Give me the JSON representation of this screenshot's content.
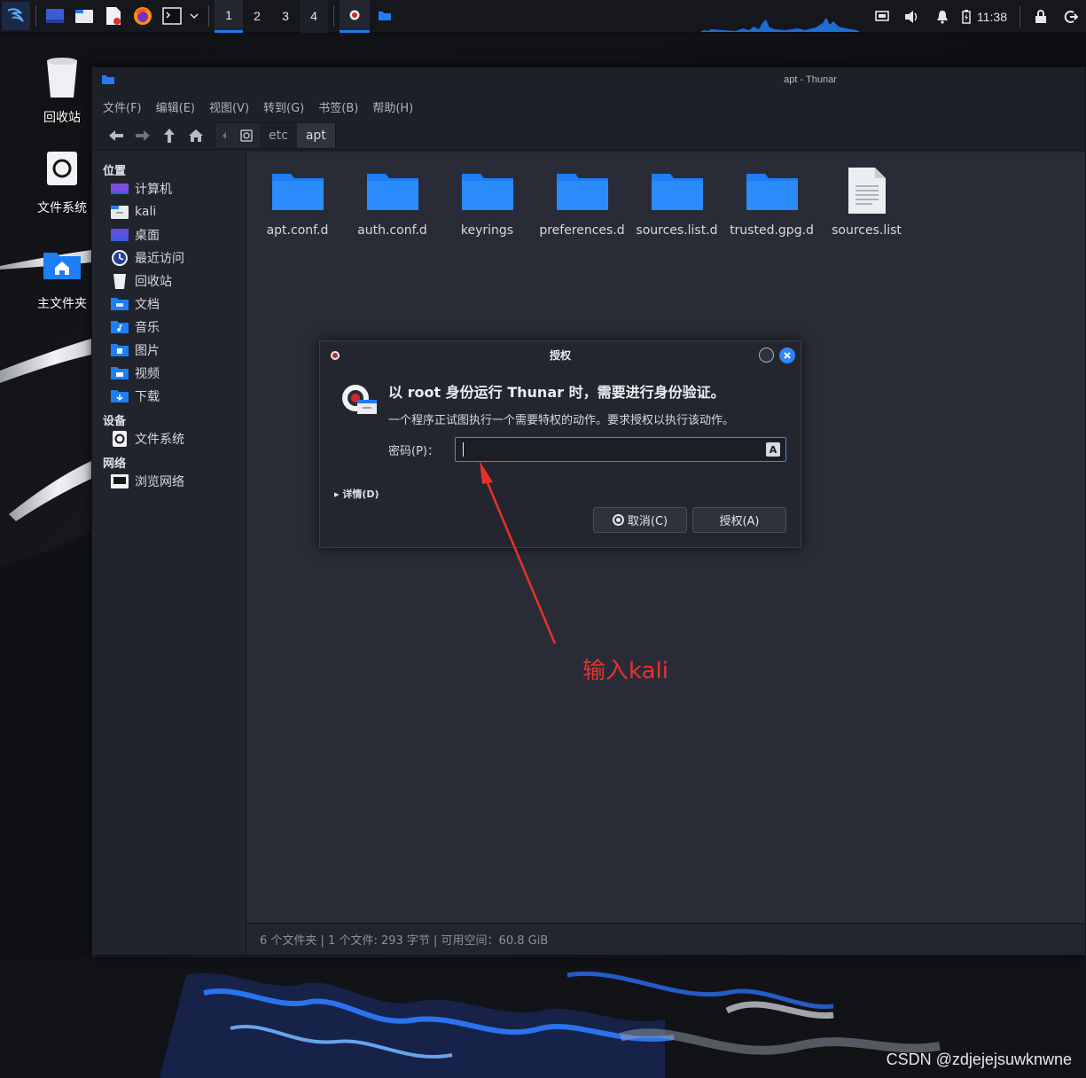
{
  "panel": {
    "workspaces": [
      "1",
      "2",
      "3",
      "4"
    ],
    "clock": "11:38"
  },
  "desktop": {
    "icons": [
      {
        "label": "回收站",
        "icon": "trash-icon"
      },
      {
        "label": "文件系统",
        "icon": "drive-icon"
      },
      {
        "label": "主文件夹",
        "icon": "home-folder-icon"
      }
    ]
  },
  "window": {
    "title": "apt - Thunar",
    "menu": [
      "文件(F)",
      "编辑(E)",
      "视图(V)",
      "转到(G)",
      "书签(B)",
      "帮助(H)"
    ],
    "breadcrumbs": [
      "etc",
      "apt"
    ],
    "sidebar": {
      "places_heading": "位置",
      "places": [
        {
          "label": "计算机",
          "icon": "computer-icon"
        },
        {
          "label": "kali",
          "icon": "home-icon"
        },
        {
          "label": "桌面",
          "icon": "desktop-icon"
        },
        {
          "label": "最近访问",
          "icon": "recent-icon"
        },
        {
          "label": "回收站",
          "icon": "trash-icon"
        },
        {
          "label": "文档",
          "icon": "documents-icon"
        },
        {
          "label": "音乐",
          "icon": "music-icon"
        },
        {
          "label": "图片",
          "icon": "pictures-icon"
        },
        {
          "label": "视频",
          "icon": "videos-icon"
        },
        {
          "label": "下载",
          "icon": "downloads-icon"
        }
      ],
      "devices_heading": "设备",
      "devices": [
        {
          "label": "文件系统",
          "icon": "drive-icon"
        }
      ],
      "network_heading": "网络",
      "network": [
        {
          "label": "浏览网络",
          "icon": "network-icon"
        }
      ]
    },
    "files": [
      {
        "name": "apt.conf.d",
        "type": "folder"
      },
      {
        "name": "auth.conf.d",
        "type": "folder"
      },
      {
        "name": "keyrings",
        "type": "folder"
      },
      {
        "name": "preferences.d",
        "type": "folder"
      },
      {
        "name": "sources.list.d",
        "type": "folder"
      },
      {
        "name": "trusted.gpg.d",
        "type": "folder"
      },
      {
        "name": "sources.list",
        "type": "file"
      }
    ],
    "status": "6 个文件夹 | 1 个文件: 293 字节 | 可用空间：60.8 GiB"
  },
  "dialog": {
    "title": "授权",
    "heading": "以 root 身份运行 Thunar 时，需要进行身份验证。",
    "description": "一个程序正试图执行一个需要特权的动作。要求授权以执行该动作。",
    "password_label": "密码(P)：",
    "password_value": "",
    "details_label": "详情(D)",
    "cancel_label": "取消(C)",
    "authorize_label": "授权(A)"
  },
  "annotation": {
    "text": "输入kali"
  },
  "watermark": "CSDN @zdjejejsuwknwne",
  "colors": {
    "accent": "#1f7ae8",
    "folder": "#1e7ef5",
    "annotation": "#e8322a"
  }
}
